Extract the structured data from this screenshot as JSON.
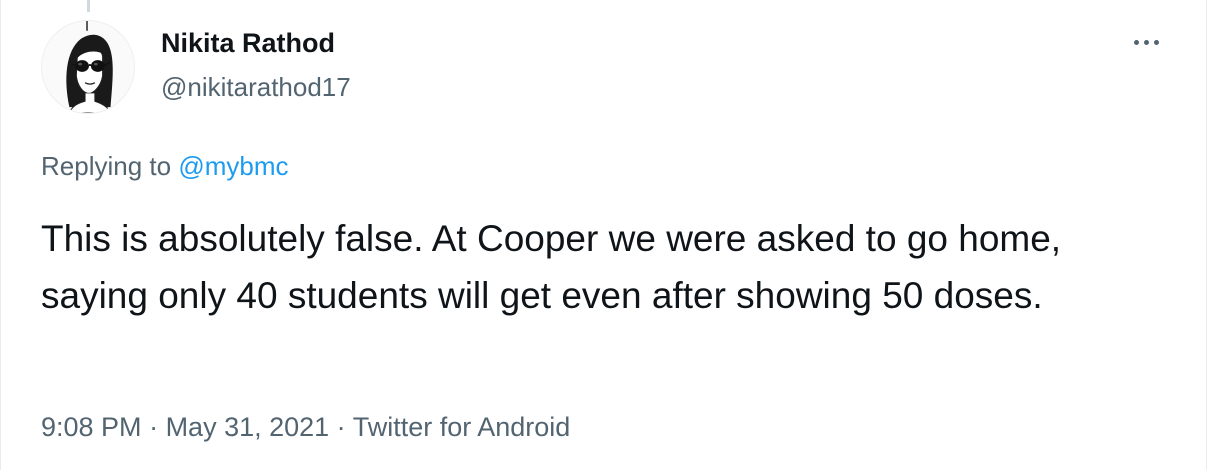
{
  "author": {
    "display_name": "Nikita Rathod",
    "handle": "@nikitarathod17"
  },
  "reply": {
    "prefix": "Replying to ",
    "mention": "@mybmc"
  },
  "tweet": {
    "text": "This is absolutely false. At Cooper we were asked to go home, saying only 40 students will get even after showing 50 doses."
  },
  "meta": {
    "time": "9:08 PM",
    "separator": " · ",
    "date": "May 31, 2021",
    "source": "Twitter for Android"
  },
  "icons": {
    "more": "more-options-icon",
    "avatar": "profile-avatar"
  },
  "colors": {
    "link": "#1d9bf0",
    "secondary_text": "#536471",
    "primary_text": "#0f1419"
  }
}
